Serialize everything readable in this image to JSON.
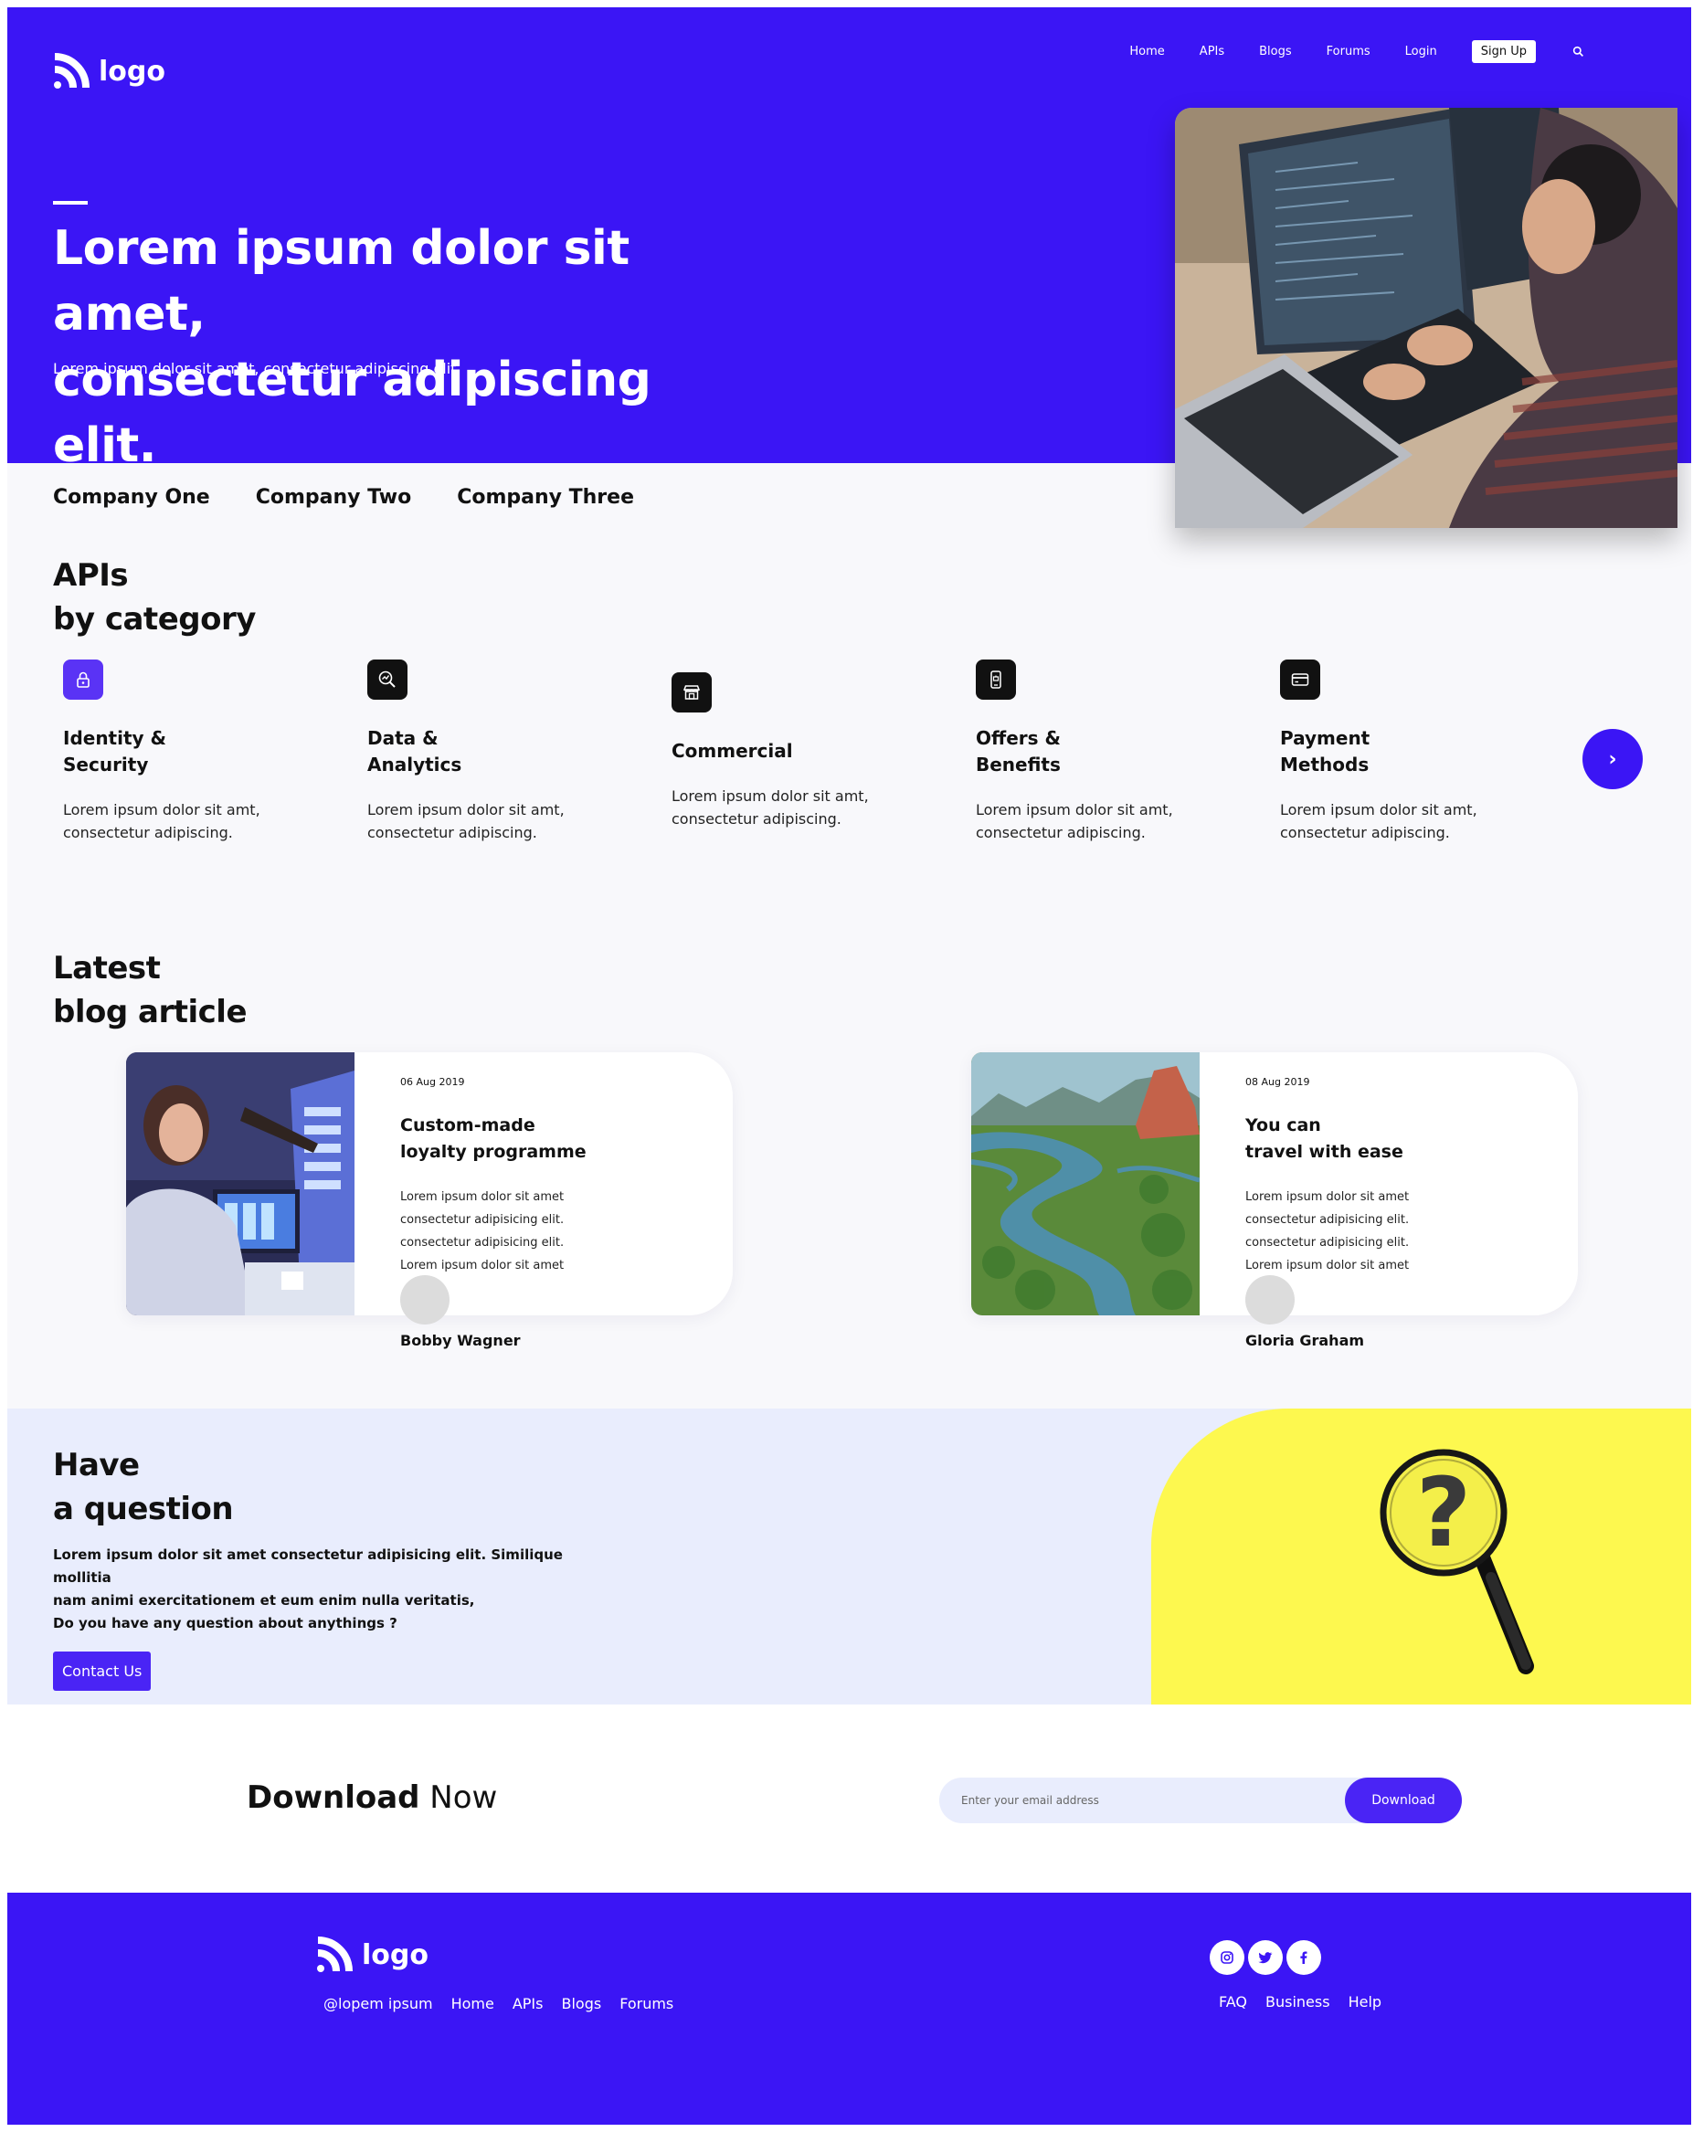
{
  "brand": {
    "logo_text": "logo",
    "primary_color": "#3b15f5",
    "accent_yellow": "#fdf84f"
  },
  "nav": {
    "items": [
      "Home",
      "APIs",
      "Blogs",
      "Forums",
      "Login"
    ],
    "signup": "Sign Up",
    "search_icon": "search-icon"
  },
  "hero": {
    "title_line1": "Lorem ipsum dolor sit amet,",
    "title_line2": "consectetur adipiscing elit.",
    "subtitle": "Lorem ipsum dolor sit amet, consectetur adipiscing elit."
  },
  "companies": [
    "Company One",
    "Company Two",
    "Company Three"
  ],
  "apis": {
    "title_line1": "APIs",
    "title_line2": "by category",
    "categories": [
      {
        "name_line1": "Identity &",
        "name_line2": "Security",
        "desc_line1": "Lorem ipsum dolor sit amt,",
        "desc_line2": "consectetur adipiscing.",
        "icon": "lock-icon"
      },
      {
        "name_line1": "Data &",
        "name_line2": "Analytics",
        "desc_line1": "Lorem ipsum dolor sit amt,",
        "desc_line2": "consectetur adipiscing.",
        "icon": "analytics-search-icon"
      },
      {
        "name_line1": "Commercial",
        "name_line2": "",
        "desc_line1": "Lorem ipsum dolor sit amt,",
        "desc_line2": "consectetur adipiscing.",
        "icon": "store-icon"
      },
      {
        "name_line1": "Offers &",
        "name_line2": "Benefits",
        "desc_line1": "Lorem ipsum dolor sit amt,",
        "desc_line2": "consectetur adipiscing.",
        "icon": "mobile-offer-icon"
      },
      {
        "name_line1": "Payment",
        "name_line2": "Methods",
        "desc_line1": "Lorem ipsum dolor sit amt,",
        "desc_line2": "consectetur adipiscing.",
        "icon": "credit-card-icon"
      }
    ],
    "next_icon": "chevron-right-icon"
  },
  "blog": {
    "title_line1": "Latest",
    "title_line2": "blog article",
    "articles": [
      {
        "date": "06 Aug 2019",
        "title_line1": "Custom-made",
        "title_line2": "loyalty programme",
        "text": [
          "Lorem ipsum dolor sit amet",
          "consectetur adipisicing elit.",
          "consectetur adipisicing elit.",
          "Lorem ipsum dolor sit amet"
        ],
        "author": "Bobby Wagner"
      },
      {
        "date": "08 Aug 2019",
        "title_line1": "You can",
        "title_line2": "travel with ease",
        "text": [
          "Lorem ipsum dolor sit amet",
          "consectetur adipisicing elit.",
          "consectetur adipisicing elit.",
          "Lorem ipsum dolor sit amet"
        ],
        "author": "Gloria Graham"
      }
    ]
  },
  "question": {
    "title_line1": "Have",
    "title_line2": "a question",
    "text_line1": "Lorem ipsum dolor sit amet consectetur adipisicing elit. Similique mollitia",
    "text_line2": "nam animi exercitationem et eum enim nulla veritatis,",
    "ask": "Do you have any question about anythings ?",
    "button": "Contact Us"
  },
  "download": {
    "title_bold": "Download",
    "title_rest": " Now",
    "placeholder": "Enter your email address",
    "button": "Download"
  },
  "footer": {
    "logo_text": "logo",
    "left_links": [
      "@lopem ipsum",
      "Home",
      "APIs",
      "Blogs",
      "Forums"
    ],
    "right_links": [
      "FAQ",
      "Business",
      "Help"
    ],
    "social_icons": [
      "instagram-icon",
      "twitter-icon",
      "facebook-icon"
    ]
  }
}
